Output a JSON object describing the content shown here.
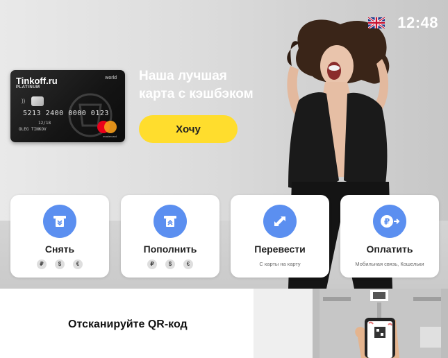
{
  "status": {
    "language_flag": "uk-flag-icon",
    "time": "12:48"
  },
  "promo": {
    "card": {
      "brand": "Tinkoff.ru",
      "tier": "PLATINUM",
      "network_tier": "world",
      "number": "5213 2400 0000 0123",
      "expiry": "12/18",
      "holder": "OLEG TINKOV",
      "network": "mastercard"
    },
    "title_line1": "Наша лучшая",
    "title_line2": "карта с кэшбэком",
    "cta_label": "Хочу"
  },
  "actions": [
    {
      "label": "Снять",
      "icon": "atm-withdraw-icon",
      "currencies": [
        "₽",
        "$",
        "€"
      ],
      "subtitle": ""
    },
    {
      "label": "Пополнить",
      "icon": "atm-deposit-icon",
      "currencies": [
        "₽",
        "$",
        "€"
      ],
      "subtitle": ""
    },
    {
      "label": "Перевести",
      "icon": "transfer-arrows-icon",
      "currencies": [],
      "subtitle": "С карты на карту"
    },
    {
      "label": "Оплатить",
      "icon": "ruble-pay-icon",
      "currencies": [],
      "subtitle": "Мобильная связь, Кошельки"
    }
  ],
  "qr": {
    "text": "Отсканируйте QR-код"
  },
  "colors": {
    "accent_yellow": "#ffdd2d",
    "icon_blue": "#5b8ff0",
    "tile_bg": "#ffffff"
  }
}
